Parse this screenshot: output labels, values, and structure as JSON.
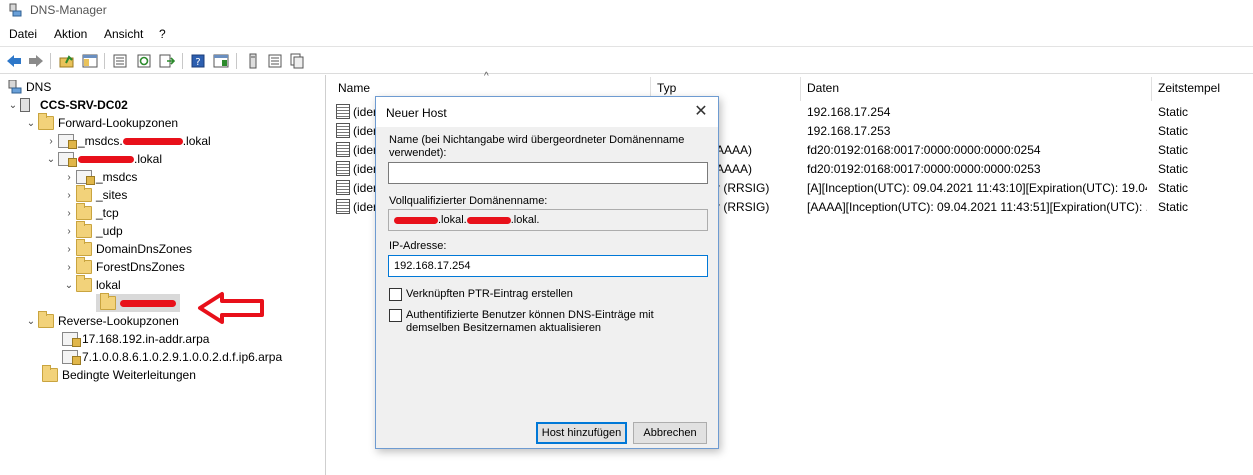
{
  "window": {
    "title": "DNS-Manager"
  },
  "menu": [
    "Datei",
    "Aktion",
    "Ansicht",
    "?"
  ],
  "toolbar": {
    "icons": [
      "back-icon",
      "forward-icon",
      "up-folder-icon",
      "show-tree-icon",
      "properties-icon",
      "refresh-icon",
      "export-icon",
      "help-icon",
      "console-icon",
      "server-icon",
      "list-icon",
      "zone-icon"
    ]
  },
  "tree": {
    "root": "DNS",
    "server": "CCS-SRV-DC02",
    "forward_zones": "Forward-Lookupzonen",
    "msdcs_zone_prefix": "_msdcs.",
    "msdcs_zone_suffix": ".lokal",
    "domain_zone_suffix": ".lokal",
    "children": [
      "_msdcs",
      "_sites",
      "_tcp",
      "_udp",
      "DomainDnsZones",
      "ForestDnsZones",
      "lokal"
    ],
    "reverse_zones": "Reverse-Lookupzonen",
    "reverse_children": [
      "17.168.192.in-addr.arpa",
      "7.1.0.0.8.6.1.0.2.9.1.0.0.2.d.f.ip6.arpa"
    ],
    "conditional": "Bedingte Weiterleitungen"
  },
  "list": {
    "columns": {
      "name": "Name",
      "type": "Typ",
      "data": "Daten",
      "timestamp": "Zeitstempel"
    },
    "rows": [
      {
        "name": "(ider",
        "type": "",
        "data": "192.168.17.254",
        "timestamp": "Static"
      },
      {
        "name": "(ider",
        "type": "",
        "data": "192.168.17.253",
        "timestamp": "Static"
      },
      {
        "name": "(ider",
        "type": "AAAA)",
        "data": "fd20:0192:0168:0017:0000:0000:0000:0254",
        "timestamp": "Static"
      },
      {
        "name": "(ider",
        "type": "AAAA)",
        "data": "fd20:0192:0168:0017:0000:0000:0000:0253",
        "timestamp": "Static"
      },
      {
        "name": "(ider",
        "type": "r (RRSIG)",
        "data": "[A][Inception(UTC): 09.04.2021 11:43:10][Expiration(UTC): 19.04...",
        "timestamp": "Static"
      },
      {
        "name": "(ider",
        "type": "r (RRSIG)",
        "data": "[AAAA][Inception(UTC): 09.04.2021 11:43:51][Expiration(UTC): ...",
        "timestamp": "Static"
      }
    ]
  },
  "dialog": {
    "title": "Neuer Host",
    "name_label": "Name (bei Nichtangabe wird übergeordneter Domänenname verwendet):",
    "name_value": "",
    "fqdn_label": "Vollqualifizierter Domänenname:",
    "fqdn_part1": ".lokal.",
    "fqdn_part2": ".lokal.",
    "ip_label": "IP-Adresse:",
    "ip_value": "192.168.17.254",
    "ptr_label": "Verknüpften PTR-Eintrag erstellen",
    "auth_label": "Authentifizierte Benutzer können DNS-Einträge mit demselben Besitzernamen aktualisieren",
    "add_button": "Host hinzufügen",
    "cancel_button": "Abbrechen",
    "close_glyph": "✕"
  },
  "colors": {
    "redaction": "#e8101a",
    "annotation_arrow": "#e8101a",
    "dialog_accent": "#0078d7"
  }
}
